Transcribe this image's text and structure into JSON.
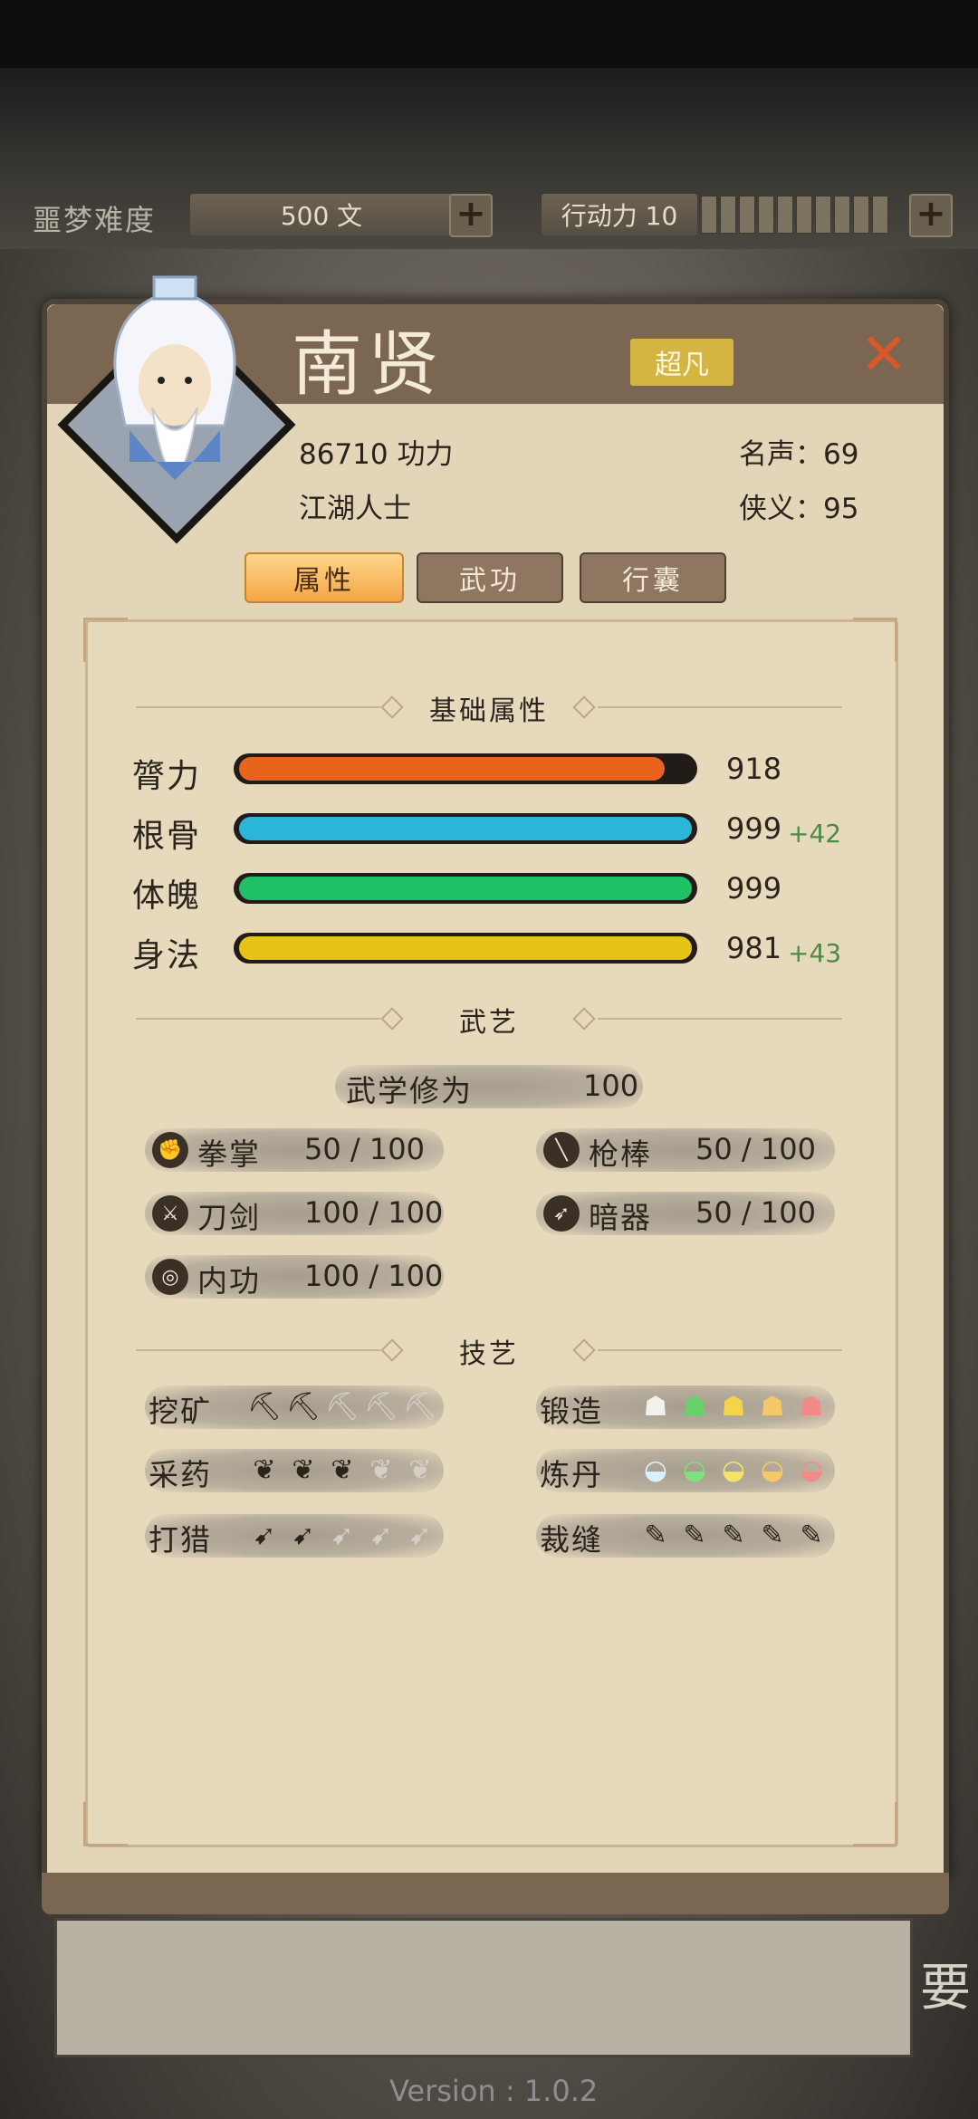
{
  "top_bar": {
    "difficulty_label": "噩梦难度",
    "money_value": "500 文",
    "action_label": "行动力 10",
    "action_segments": 10
  },
  "character": {
    "name": "南贤",
    "rank": "超凡",
    "power": "86710 功力",
    "identity": "江湖人士",
    "fame_label": "名声：",
    "fame_value": "69",
    "chivalry_label": "侠义：",
    "chivalry_value": "95"
  },
  "tabs": [
    {
      "label": "属性",
      "active": true
    },
    {
      "label": "武功",
      "active": false
    },
    {
      "label": "行囊",
      "active": false
    }
  ],
  "sections": {
    "basic": "基础属性",
    "martial": "武艺",
    "craft": "技艺"
  },
  "attributes": [
    {
      "label": "膂力",
      "value": "918",
      "bonus": "",
      "fill": 0.94,
      "color": "#e8641c"
    },
    {
      "label": "根骨",
      "value": "999",
      "bonus": "+42",
      "fill": 1.0,
      "color": "#2bb6d8"
    },
    {
      "label": "体魄",
      "value": "999",
      "bonus": "",
      "fill": 1.0,
      "color": "#1fc166"
    },
    {
      "label": "身法",
      "value": "981",
      "bonus": "+43",
      "fill": 1.0,
      "color": "#e6c417"
    }
  ],
  "martial": {
    "cultivation_label": "武学修为",
    "cultivation_value": "100",
    "skills": [
      {
        "label": "拳掌",
        "value": "50 / 100",
        "icon": "fist-icon"
      },
      {
        "label": "枪棒",
        "value": "50 / 100",
        "icon": "spear-icon"
      },
      {
        "label": "刀剑",
        "value": "100 / 100",
        "icon": "sword-icon"
      },
      {
        "label": "暗器",
        "value": "50 / 100",
        "icon": "dart-icon"
      },
      {
        "label": "内功",
        "value": "100 / 100",
        "icon": "inner-force-icon"
      }
    ]
  },
  "crafts": [
    {
      "label": "挖矿",
      "level": 2,
      "max": 5,
      "icon": "pickaxe-icon"
    },
    {
      "label": "锻造",
      "level": 5,
      "max": 5,
      "icon": "anvil-icon"
    },
    {
      "label": "采药",
      "level": 3,
      "max": 5,
      "icon": "herb-icon"
    },
    {
      "label": "炼丹",
      "level": 5,
      "max": 5,
      "icon": "bowl-icon"
    },
    {
      "label": "打猎",
      "level": 2,
      "max": 5,
      "icon": "bow-icon"
    },
    {
      "label": "裁缝",
      "level": 5,
      "max": 5,
      "icon": "needle-icon"
    }
  ],
  "footer": {
    "version": "Version : 1.0.2"
  }
}
